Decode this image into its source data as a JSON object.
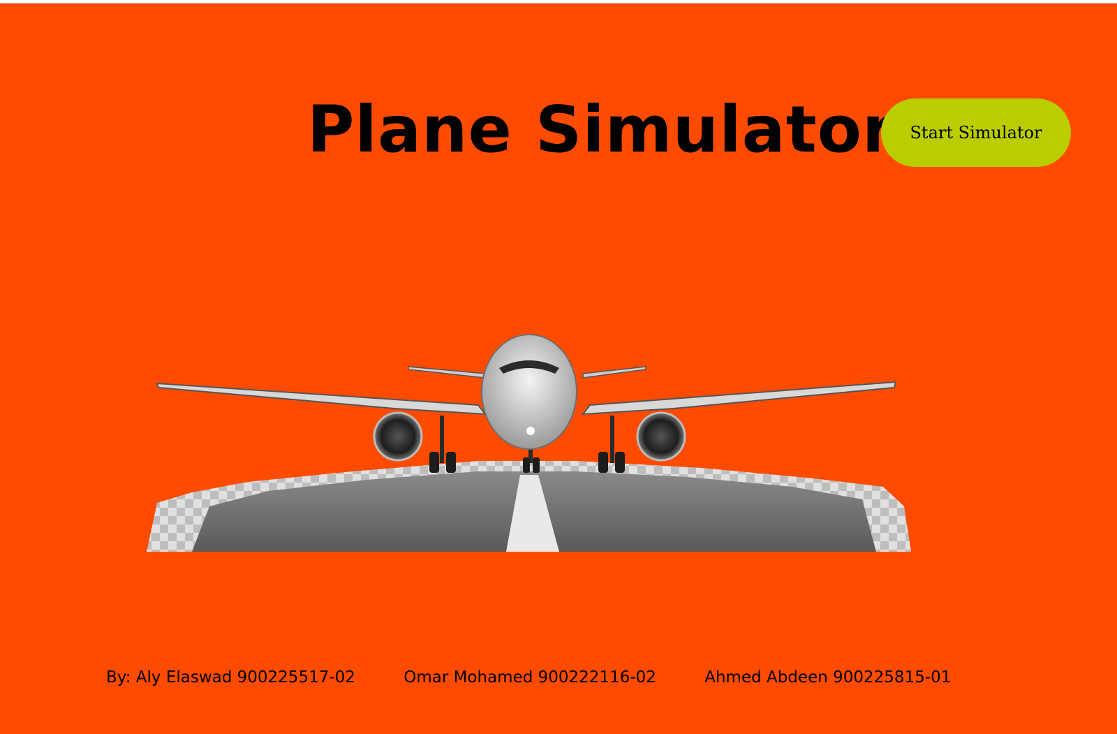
{
  "page": {
    "background_color": "#ff4b00",
    "title": "Plane Simulator"
  },
  "start_button": {
    "label": "Start Simulator",
    "color": "#b9cd00"
  },
  "hero_image": {
    "icon": "airplane-on-runway-icon"
  },
  "footer": {
    "authors": [
      "By: Aly Elaswad 900225517-02",
      "Omar Mohamed 900222116-02",
      "Ahmed Abdeen 900225815-01"
    ]
  }
}
